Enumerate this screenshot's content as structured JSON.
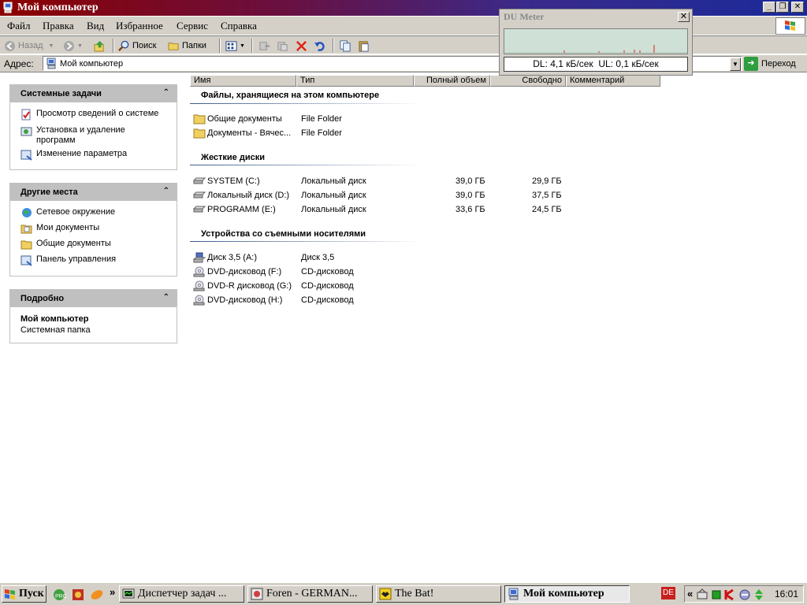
{
  "window": {
    "title": "Мой компьютер"
  },
  "menu": [
    "Файл",
    "Правка",
    "Вид",
    "Избранное",
    "Сервис",
    "Справка"
  ],
  "toolbar": {
    "back": "Назад",
    "search": "Поиск",
    "folders": "Папки"
  },
  "address": {
    "label": "Адрес:",
    "value": "Мой компьютер",
    "go": "Переход"
  },
  "panels": {
    "system_tasks": {
      "title": "Системные задачи",
      "items": [
        "Просмотр сведений о системе",
        "Установка и удаление программ",
        "Изменение параметра"
      ]
    },
    "other_places": {
      "title": "Другие места",
      "items": [
        "Сетевое окружение",
        "Мои документы",
        "Общие документы",
        "Панель управления"
      ]
    },
    "details": {
      "title": "Подробно",
      "name": "Мой компьютер",
      "desc": "Системная папка"
    }
  },
  "columns": [
    "Имя",
    "Тип",
    "Полный объем",
    "Свободно",
    "Комментарий"
  ],
  "groups": {
    "files": {
      "title": "Файлы, хранящиеся на этом компьютере",
      "rows": [
        {
          "name": "Общие документы",
          "type": "File Folder",
          "total": "",
          "free": ""
        },
        {
          "name": "Документы - Вячес...",
          "type": "File Folder",
          "total": "",
          "free": ""
        }
      ]
    },
    "disks": {
      "title": "Жесткие диски",
      "rows": [
        {
          "name": "SYSTEM (C:)",
          "type": "Локальный диск",
          "total": "39,0 ГБ",
          "free": "29,9 ГБ"
        },
        {
          "name": "Локальный диск (D:)",
          "type": "Локальный диск",
          "total": "39,0 ГБ",
          "free": "37,5 ГБ"
        },
        {
          "name": "PROGRAMM (E:)",
          "type": "Локальный диск",
          "total": "33,6 ГБ",
          "free": "24,5 ГБ"
        }
      ]
    },
    "removable": {
      "title": "Устройства со съемными носителями",
      "rows": [
        {
          "name": "Диск 3,5 (A:)",
          "type": "Диск 3,5",
          "total": "",
          "free": ""
        },
        {
          "name": "DVD-дисковод (F:)",
          "type": "CD-дисковод",
          "total": "",
          "free": ""
        },
        {
          "name": "DVD-R дисковод (G:)",
          "type": "CD-дисковод",
          "total": "",
          "free": ""
        },
        {
          "name": "DVD-дисковод (H:)",
          "type": "CD-дисковод",
          "total": "",
          "free": ""
        }
      ]
    }
  },
  "du_meter": {
    "title": "DU Meter",
    "readout": "DL: 4,1 кБ/сек  UL: 0,1 кБ/сек"
  },
  "taskbar": {
    "start": "Пуск",
    "tasks": [
      "Диспетчер задач ...",
      "Foren - GERMAN...",
      "The Bat!",
      "Мой компьютер"
    ],
    "lang": "DE",
    "clock": "16:01"
  }
}
